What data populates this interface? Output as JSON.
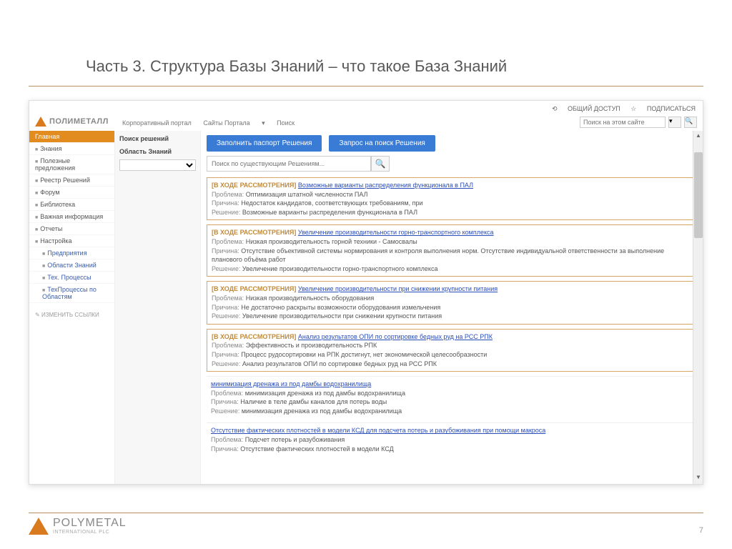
{
  "slide": {
    "title": "Часть 3. Структура Базы Знаний – что такое База Знаний",
    "page": "7"
  },
  "brand": {
    "name": "ПОЛИМЕТАЛЛ"
  },
  "footer_brand": {
    "name": "POLYMETAL",
    "sub": "INTERNATIONAL PLC"
  },
  "top_actions": {
    "share": "ОБЩИЙ ДОСТУП",
    "subscribe": "ПОДПИСАТЬСЯ"
  },
  "topnav": {
    "a": "Корпоративный портал",
    "b": "Сайты Портала",
    "c": "Поиск"
  },
  "search_top": {
    "placeholder": "Поиск на этом сайте"
  },
  "sidebar": {
    "items": [
      {
        "label": "Главная",
        "active": true
      },
      {
        "label": "Знания"
      },
      {
        "label": "Полезные предложения"
      },
      {
        "label": "Реестр Решений"
      },
      {
        "label": "Форум"
      },
      {
        "label": "Библиотека"
      },
      {
        "label": "Важная информация"
      },
      {
        "label": "Отчеты"
      },
      {
        "label": "Настройка"
      }
    ],
    "subs": [
      {
        "label": "Предприятия"
      },
      {
        "label": "Области Знаний"
      },
      {
        "label": "Тех. Процессы"
      },
      {
        "label": "ТехПроцессы по Областям"
      }
    ],
    "edit": "ИЗМЕНИТЬ ССЫЛКИ"
  },
  "filter": {
    "title": "Поиск решений",
    "label": "Область Знаний"
  },
  "buttons": {
    "fill": "Заполнить паспорт Решения",
    "request": "Запрос на поиск Решения"
  },
  "search_main": {
    "placeholder": "Поиск по существующим Решениям..."
  },
  "cards": [
    {
      "status": "[В ХОДЕ РАССМОТРЕНИЯ]",
      "title": "Возможные варианты распределения функционала в ПАЛ",
      "problem_lbl": "Проблема:",
      "problem": "Оптимизация штатной численности ПАЛ",
      "reason_lbl": "Причина:",
      "reason": "Недостаток кандидатов, соответствующих требованиям, при",
      "solution_lbl": "Решение:",
      "solution": "Возможные варианты распределения функционала в ПАЛ",
      "boxed": true
    },
    {
      "status": "[В ХОДЕ РАССМОТРЕНИЯ]",
      "title": "Увеличение производительности горно-транспортного комплекса",
      "problem_lbl": "Проблема:",
      "problem": "Низкая производительность горной техники - Самосвалы",
      "reason_lbl": "Причина:",
      "reason": "Отсутствие объективной системы нормирования и контроля выполнения норм. Отсутствие индивидуальной ответственности за выполнение планового объёма работ",
      "solution_lbl": "Решение:",
      "solution": "Увеличение производительности горно-транспортного комплекса",
      "boxed": true
    },
    {
      "status": "[В ХОДЕ РАССМОТРЕНИЯ]",
      "title": "Увеличение производительности при снижении крупности питания",
      "problem_lbl": "Проблема:",
      "problem": "Низкая производительность оборудования",
      "reason_lbl": "Причина:",
      "reason": "Не достаточно раскрыты возможности оборудования измельчения",
      "solution_lbl": "Решение:",
      "solution": "Увеличение производительности при снижении крупности питания",
      "boxed": true
    },
    {
      "status": "[В ХОДЕ РАССМОТРЕНИЯ]",
      "title": "Анализ результатов ОПИ по сортировке бедных руд на РСС РПК",
      "problem_lbl": "Проблема:",
      "problem": "Эффективность и производительность РПК",
      "reason_lbl": "Причина:",
      "reason": "Процесс рудосортировки на РПК достигнут, нет экономической целесообразности",
      "solution_lbl": "Решение:",
      "solution": "Анализ результатов ОПИ по сортировке бедных руд на РСС РПК",
      "boxed": true
    },
    {
      "status": "",
      "title": "минимизация дренажа из под дамбы водохранилища",
      "problem_lbl": "Проблема:",
      "problem": "минимизация дренажа из под дамбы водохранилища",
      "reason_lbl": "Причина:",
      "reason": "Наличие в теле дамбы каналов для потерь воды",
      "solution_lbl": "Решение:",
      "solution": "минимизация дренажа из под дамбы водохранилища",
      "boxed": false
    },
    {
      "status": "",
      "title": "Отсутствие фактических плотностей в модели КСД для подсчета потерь и разубоживания при помощи макроса",
      "problem_lbl": "Проблема:",
      "problem": "Подсчет потерь и разубоживания",
      "reason_lbl": "Причина:",
      "reason": "Отсутствие фактических плотностей в модели КСД",
      "solution_lbl": "",
      "solution": "",
      "boxed": false
    }
  ]
}
